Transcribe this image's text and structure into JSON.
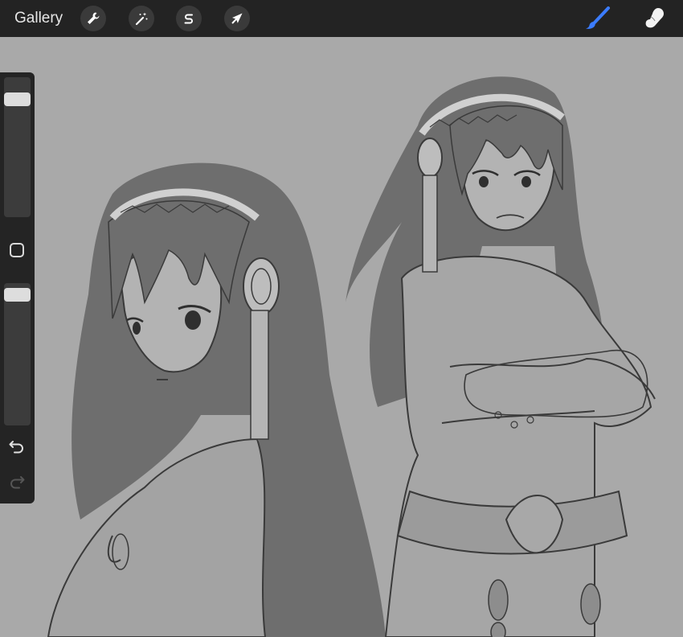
{
  "app": {
    "gallery_label": "Gallery"
  },
  "toolbar": {
    "actions_icon": "wrench-icon",
    "adjustments_icon": "magic-wand-icon",
    "selection_icon": "selection-s-icon",
    "transform_icon": "arrow-cursor-icon",
    "brush_icon": "paintbrush-icon",
    "smudge_icon": "smudge-finger-icon",
    "active_tool": "brush",
    "accent_color": "#3b7cff"
  },
  "sidebar": {
    "brush_size_level": 0.88,
    "opacity_level": 0.96,
    "modifier_icon": "square-modifier-icon",
    "undo_icon": "undo-arrow-icon",
    "redo_icon": "redo-arrow-icon",
    "redo_enabled": false
  },
  "colors": {
    "toolbar_bg": "#232323",
    "canvas_bg": "#a9a9a9",
    "hair": "#6e6e6e",
    "line": "#3a3a3a"
  }
}
